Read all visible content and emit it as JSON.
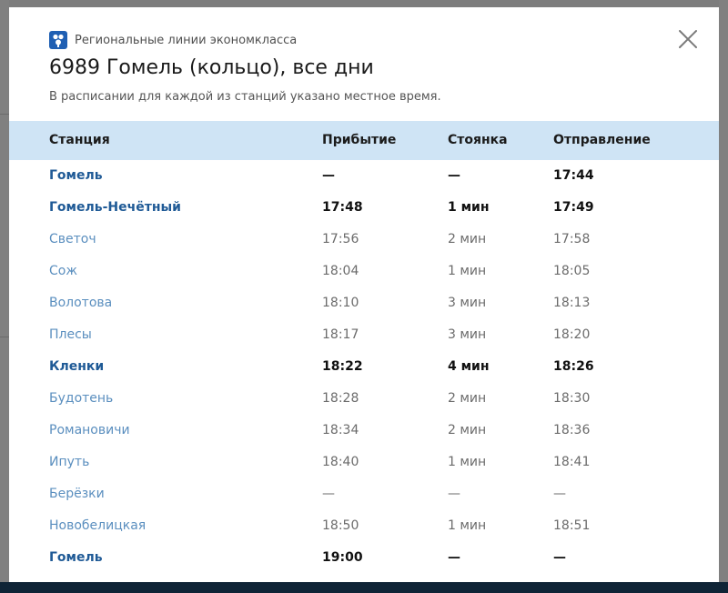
{
  "modal": {
    "brand_label": "Региональные линии экономкласса",
    "title": "6989 Гомель (кольцо), все дни",
    "subtitle": "В расписании для каждой из станций указано местное время."
  },
  "table": {
    "headers": [
      "Станция",
      "Прибытие",
      "Стоянка",
      "Отправление"
    ],
    "rows": [
      {
        "station": "Гомель",
        "arrival": "—",
        "stop": "—",
        "departure": "17:44",
        "major": true
      },
      {
        "station": "Гомель-Нечётный",
        "arrival": "17:48",
        "stop": "1 мин",
        "departure": "17:49",
        "major": true
      },
      {
        "station": "Светоч",
        "arrival": "17:56",
        "stop": "2 мин",
        "departure": "17:58",
        "major": false
      },
      {
        "station": "Сож",
        "arrival": "18:04",
        "stop": "1 мин",
        "departure": "18:05",
        "major": false
      },
      {
        "station": "Волотова",
        "arrival": "18:10",
        "stop": "3 мин",
        "departure": "18:13",
        "major": false
      },
      {
        "station": "Плесы",
        "arrival": "18:17",
        "stop": "3 мин",
        "departure": "18:20",
        "major": false
      },
      {
        "station": "Кленки",
        "arrival": "18:22",
        "stop": "4 мин",
        "departure": "18:26",
        "major": true
      },
      {
        "station": "Будотень",
        "arrival": "18:28",
        "stop": "2 мин",
        "departure": "18:30",
        "major": false
      },
      {
        "station": "Романовичи",
        "arrival": "18:34",
        "stop": "2 мин",
        "departure": "18:36",
        "major": false
      },
      {
        "station": "Ипуть",
        "arrival": "18:40",
        "stop": "1 мин",
        "departure": "18:41",
        "major": false
      },
      {
        "station": "Берёзки",
        "arrival": "—",
        "stop": "—",
        "departure": "—",
        "major": false
      },
      {
        "station": "Новобелицкая",
        "arrival": "18:50",
        "stop": "1 мин",
        "departure": "18:51",
        "major": false
      },
      {
        "station": "Гомель",
        "arrival": "19:00",
        "stop": "—",
        "departure": "—",
        "major": true
      }
    ]
  },
  "icons": {
    "close": "close-icon",
    "brand": "brand-logo-icon"
  },
  "colors": {
    "header_bg": "#cfe4f5",
    "station_major": "#1f5a96",
    "station_minor": "#5b8fbf",
    "brand": "#1f5fb3"
  }
}
